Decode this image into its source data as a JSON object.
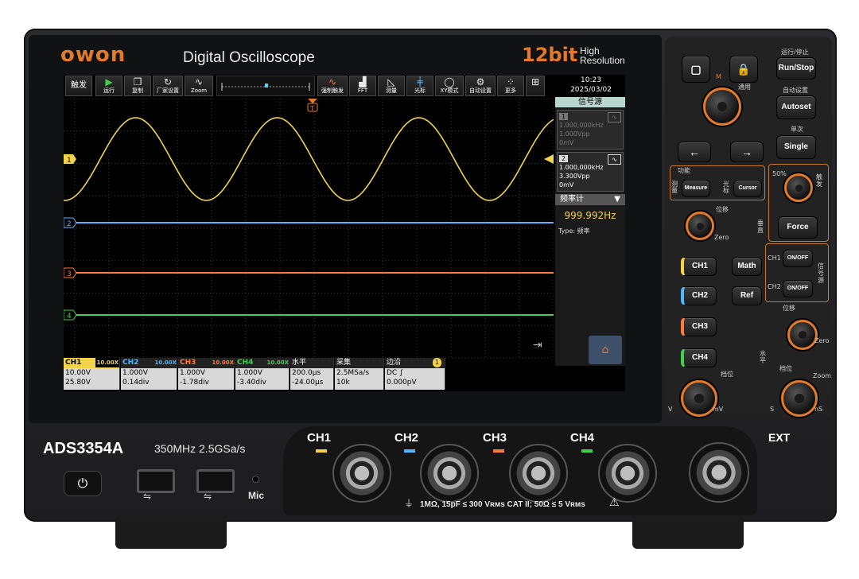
{
  "brand": {
    "logo": "owon",
    "title": "Digital Oscilloscope",
    "bit": "12bit",
    "res1": "High",
    "res2": "Resolution"
  },
  "model": {
    "name": "ADS3354A",
    "spec": "350MHz  2.5GSa/s"
  },
  "toolbar": {
    "trigger_label": "触发",
    "buttons": [
      {
        "icon": "play-icon",
        "label": "运行"
      },
      {
        "icon": "copy-icon",
        "label": "复制"
      },
      {
        "icon": "reset-icon",
        "label": "厂家设置"
      },
      {
        "icon": "zoom-icon",
        "label": "Zoom"
      },
      {
        "icon": "force-trigger-icon",
        "label": "强制触发"
      },
      {
        "icon": "fft-icon",
        "label": "FFT"
      },
      {
        "icon": "measure-icon",
        "label": "测量"
      },
      {
        "icon": "cursor-icon",
        "label": "光标"
      },
      {
        "icon": "xy-icon",
        "label": "XY模式"
      },
      {
        "icon": "autoset-icon",
        "label": "自动设置"
      },
      {
        "icon": "more-icon",
        "label": "更多"
      },
      {
        "icon": "network-icon",
        "label": ""
      }
    ],
    "time": "10:23",
    "date": "2025/03/02"
  },
  "side_panel": {
    "source_title": "信号源",
    "source1": {
      "num": "1",
      "freq": "1.000,000kHz",
      "vpp": "1.000Vpp",
      "offset": "0mV"
    },
    "source2": {
      "num": "2",
      "freq": "1.000,000kHz",
      "vpp": "3.300Vpp",
      "offset": "0mV"
    },
    "counter_title": "频率计",
    "counter_value": "999.992Hz",
    "counter_type_label": "Type:",
    "counter_type": "频率"
  },
  "bottom": {
    "ch1": {
      "name": "CH1",
      "probe": "10.00X",
      "scale": "10.00V",
      "offset": "25.80V",
      "color": "#f2d34a"
    },
    "ch2": {
      "name": "CH2",
      "probe": "10.00X",
      "scale": "1.000V",
      "offset": "0.14div",
      "color": "#52b6ff"
    },
    "ch3": {
      "name": "CH3",
      "probe": "10.00X",
      "scale": "1.000V",
      "offset": "-1.78div",
      "color": "#ff7a3d"
    },
    "ch4": {
      "name": "CH4",
      "probe": "10.00X",
      "scale": "1.000V",
      "offset": "-3.40div",
      "color": "#3fd14b"
    },
    "horizontal": {
      "name": "水平",
      "timebase": "200.0µs",
      "delay": "-24.00µs"
    },
    "acquire": {
      "name": "采集",
      "rate": "2.5MSa/s",
      "depth": "10k"
    },
    "edge": {
      "name": "边沿",
      "channel": "1",
      "coupling": "DC",
      "level": "0.000pV"
    }
  },
  "markers": [
    "1",
    "2",
    "3",
    "4"
  ],
  "trigger_marker": "T",
  "panel": {
    "run_stop_caption": "运行/停止",
    "run_stop": "Run/Stop",
    "autoset_caption": "自动设置",
    "autoset": "Autoset",
    "single_caption": "单次",
    "single": "Single",
    "function_label": "功能",
    "measure_side": "测量",
    "measure": "Measure",
    "cursor_side": "光标",
    "cursor": "Cursor",
    "trigger_side": "触发",
    "force": "Force",
    "position_label": "位移",
    "vertical_label": "垂直",
    "math": "Math",
    "ref": "Ref",
    "ch1": "CH1",
    "ch2": "CH2",
    "ch3": "CH3",
    "ch4": "CH4",
    "source_ch1": "CH1",
    "source_ch2": "CH2",
    "onoff": "ON/OFF",
    "signal_source_side": "信号源",
    "horizontal_side": "水平",
    "scale_label": "档位",
    "zero": "Zero",
    "zoom": "Zoom",
    "v": "V",
    "mv": "mV",
    "s": "S",
    "ns": "nS",
    "m": "M",
    "general": "通用",
    "pct50": "50%"
  },
  "front": {
    "inputs": [
      "CH1",
      "CH2",
      "CH3",
      "CH4"
    ],
    "ext": "EXT",
    "mic": "Mic",
    "spec": "1MΩ, 15pF ≤ 300 Vʀᴍs CAT II; 50Ω ≤ 5 Vʀᴍs"
  },
  "colors": {
    "ch1": "#f2d34a",
    "ch2": "#52b6ff",
    "ch3": "#ff7a3d",
    "ch4": "#3fd14b",
    "accent": "#e3792b"
  }
}
